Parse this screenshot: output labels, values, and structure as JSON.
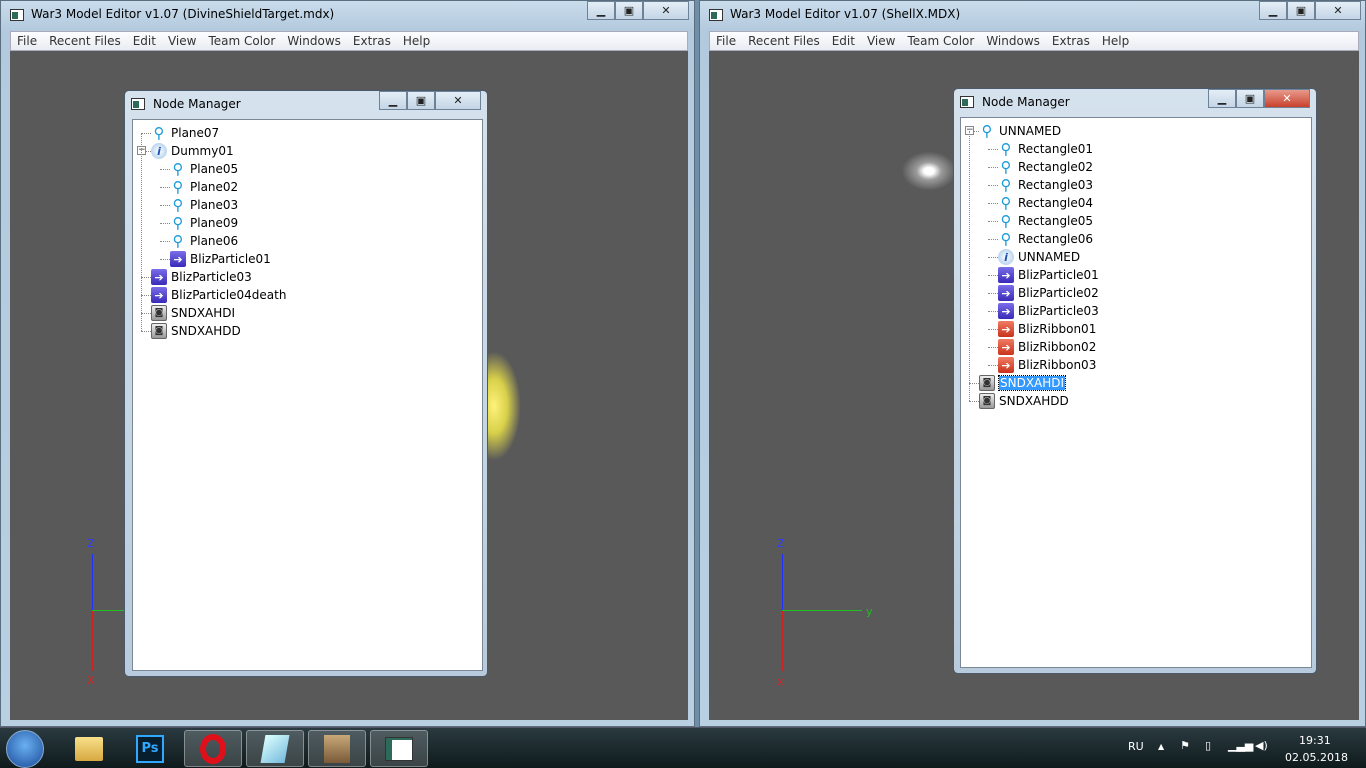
{
  "left_window": {
    "title": "War3 Model Editor v1.07 (DivineShieldTarget.mdx)",
    "menu": [
      "File",
      "Recent Files",
      "Edit",
      "View",
      "Team Color",
      "Windows",
      "Extras",
      "Help"
    ],
    "node_manager": {
      "title": "Node Manager",
      "nodes": [
        {
          "label": "Plane07",
          "icon": "bone",
          "level": 0
        },
        {
          "label": "Dummy01",
          "icon": "info",
          "level": 0,
          "expanded": true
        },
        {
          "label": "Plane05",
          "icon": "bone",
          "level": 1
        },
        {
          "label": "Plane02",
          "icon": "bone",
          "level": 1
        },
        {
          "label": "Plane03",
          "icon": "bone",
          "level": 1
        },
        {
          "label": "Plane09",
          "icon": "bone",
          "level": 1
        },
        {
          "label": "Plane06",
          "icon": "bone",
          "level": 1
        },
        {
          "label": "BlizParticle01",
          "icon": "particle",
          "level": 1
        },
        {
          "label": "BlizParticle03",
          "icon": "particle",
          "level": 0
        },
        {
          "label": "BlizParticle04death",
          "icon": "particle",
          "level": 0
        },
        {
          "label": "SNDXAHDI",
          "icon": "sound",
          "level": 0
        },
        {
          "label": "SNDXAHDD",
          "icon": "sound",
          "level": 0
        }
      ]
    },
    "axes": {
      "z": "Z",
      "x": "X"
    }
  },
  "right_window": {
    "title": "War3 Model Editor v1.07 (ShellX.MDX)",
    "menu": [
      "File",
      "Recent Files",
      "Edit",
      "View",
      "Team Color",
      "Windows",
      "Extras",
      "Help"
    ],
    "node_manager": {
      "title": "Node Manager",
      "nodes": [
        {
          "label": "UNNAMED",
          "icon": "bone",
          "level": 0,
          "expanded": true
        },
        {
          "label": "Rectangle01",
          "icon": "bone",
          "level": 1
        },
        {
          "label": "Rectangle02",
          "icon": "bone",
          "level": 1
        },
        {
          "label": "Rectangle03",
          "icon": "bone",
          "level": 1
        },
        {
          "label": "Rectangle04",
          "icon": "bone",
          "level": 1
        },
        {
          "label": "Rectangle05",
          "icon": "bone",
          "level": 1
        },
        {
          "label": "Rectangle06",
          "icon": "bone",
          "level": 1
        },
        {
          "label": "UNNAMED",
          "icon": "info",
          "level": 1
        },
        {
          "label": "BlizParticle01",
          "icon": "particle",
          "level": 1
        },
        {
          "label": "BlizParticle02",
          "icon": "particle",
          "level": 1
        },
        {
          "label": "BlizParticle03",
          "icon": "particle",
          "level": 1
        },
        {
          "label": "BlizRibbon01",
          "icon": "ribbon",
          "level": 1
        },
        {
          "label": "BlizRibbon02",
          "icon": "ribbon",
          "level": 1
        },
        {
          "label": "BlizRibbon03",
          "icon": "ribbon",
          "level": 1
        },
        {
          "label": "SNDXAHDI",
          "icon": "sound",
          "level": 0,
          "selected": true
        },
        {
          "label": "SNDXAHDD",
          "icon": "sound",
          "level": 0
        }
      ]
    },
    "axes": {
      "z": "Z",
      "y": "y",
      "x": "x"
    }
  },
  "taskbar": {
    "apps": [
      "explorer",
      "photoshop",
      "opera",
      "notepad",
      "script-editor",
      "war3-model-editor"
    ],
    "ps_label": "Ps",
    "lang": "RU",
    "time": "19:31",
    "date": "02.05.2018"
  }
}
